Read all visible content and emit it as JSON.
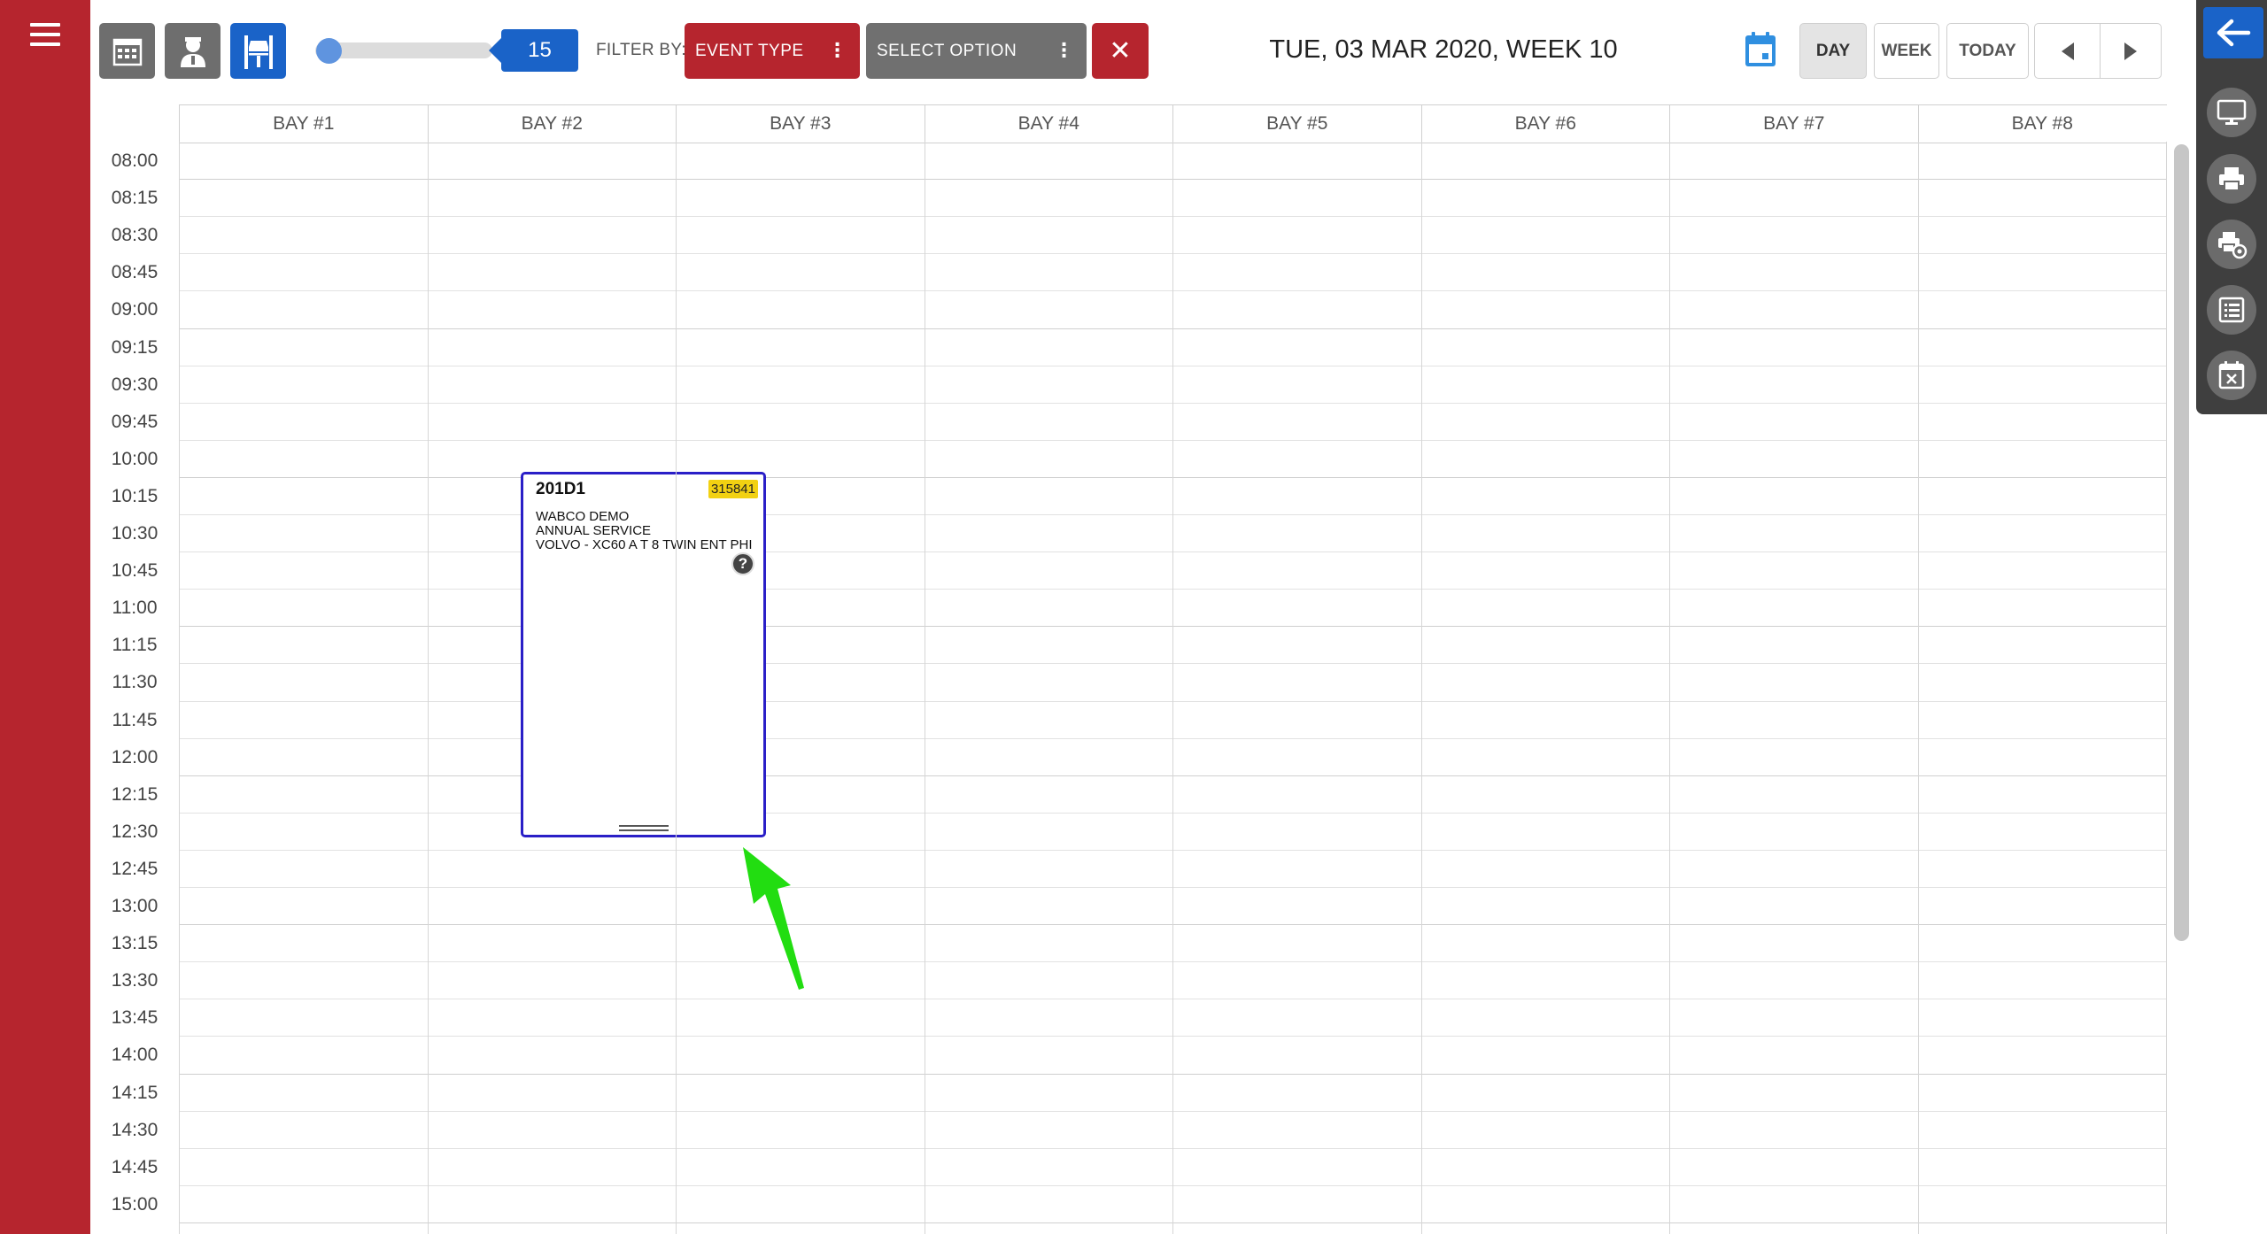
{
  "toolbar": {
    "interval_value": "15",
    "filter_label": "FILTER BY:",
    "event_type_label": "EVENT TYPE",
    "select_option_label": "SELECT OPTION",
    "clear_symbol": "✕",
    "kebab_symbol": "⋮"
  },
  "header": {
    "date_title": "TUE, 03 MAR 2020, WEEK 10"
  },
  "view_buttons": {
    "day": "DAY",
    "week": "WEEK",
    "today": "TODAY",
    "active": "DAY"
  },
  "columns": [
    "BAY #1",
    "BAY #2",
    "BAY #3",
    "BAY #4",
    "BAY #5",
    "BAY #6",
    "BAY #7",
    "BAY #8"
  ],
  "time_slots": [
    "08:00",
    "08:15",
    "08:30",
    "08:45",
    "09:00",
    "09:15",
    "09:30",
    "09:45",
    "10:00",
    "10:15",
    "10:30",
    "10:45",
    "11:00",
    "11:15",
    "11:30",
    "11:45",
    "12:00",
    "12:15",
    "12:30",
    "12:45",
    "13:00",
    "13:15",
    "13:30",
    "13:45",
    "14:00",
    "14:15",
    "14:30",
    "14:45",
    "15:00"
  ],
  "event": {
    "code": "201D1",
    "job_number": "315841",
    "customer": "WABCO DEMO",
    "service": "ANNUAL SERVICE",
    "vehicle": "VOLVO - XC60 A T 8 TWIN ENT PHI",
    "help_symbol": "?",
    "bay": "BAY #2",
    "start": "09:30",
    "end": "12:00"
  },
  "colors": {
    "brand_red": "#b6252e",
    "accent_blue": "#1a63c8",
    "event_border": "#2a1fc7",
    "badge_yellow": "#f2d112",
    "arrow_green": "#22dd11"
  },
  "icons": {
    "menu": "hamburger-icon",
    "calendar_view": "calendar-grid-icon",
    "technician_view": "technician-icon",
    "bay_view": "vehicle-lift-icon",
    "date_picker": "calendar-icon",
    "prev": "triangle-left-icon",
    "next": "triangle-right-icon",
    "rail_back": "arrow-left-icon",
    "rail_items": [
      "monitor-icon",
      "printer-icon",
      "printer-settings-icon",
      "list-icon",
      "calendar-cancel-icon"
    ]
  }
}
